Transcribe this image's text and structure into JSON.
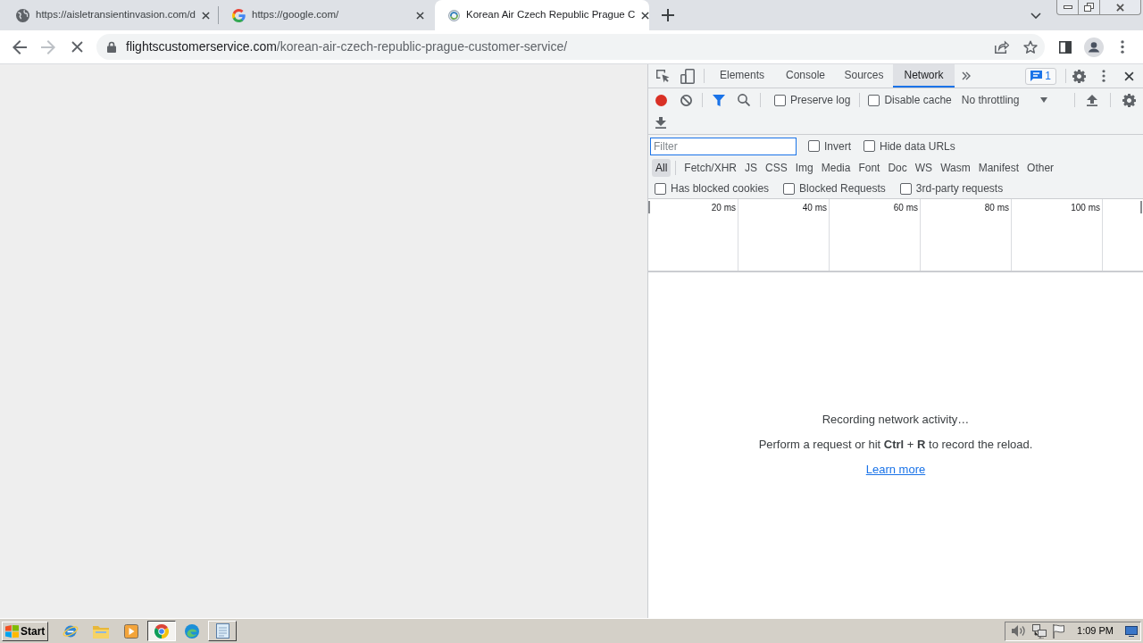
{
  "browser": {
    "tabs": [
      {
        "title": "https://aisletransientinvasion.com/d",
        "selected": false
      },
      {
        "title": "https://google.com/",
        "selected": false
      },
      {
        "title": "Korean Air Czech Republic Prague C",
        "selected": true
      }
    ],
    "loading": true,
    "forward_disabled": true,
    "url": {
      "domain": "flightscustomerservice.com",
      "path": "/korean-air-czech-republic-prague-customer-service/"
    }
  },
  "devtools": {
    "tabs": [
      {
        "label": "Elements",
        "selected": false
      },
      {
        "label": "Console",
        "selected": false
      },
      {
        "label": "Sources",
        "selected": false
      },
      {
        "label": "Network",
        "selected": true
      }
    ],
    "issues_count": "1",
    "network": {
      "recording": true,
      "options": [
        {
          "label": "Preserve log",
          "checked": false
        },
        {
          "label": "Disable cache",
          "checked": false
        }
      ],
      "throttling": "No throttling",
      "filter": {
        "placeholder": "Filter"
      },
      "filter_options": [
        {
          "label": "Invert",
          "checked": false
        },
        {
          "label": "Hide data URLs",
          "checked": false
        }
      ],
      "resource_types": [
        {
          "label": "All",
          "selected": true
        },
        {
          "label": "Fetch/XHR",
          "selected": false
        },
        {
          "label": "JS",
          "selected": false
        },
        {
          "label": "CSS",
          "selected": false
        },
        {
          "label": "Img",
          "selected": false
        },
        {
          "label": "Media",
          "selected": false
        },
        {
          "label": "Font",
          "selected": false
        },
        {
          "label": "Doc",
          "selected": false
        },
        {
          "label": "WS",
          "selected": false
        },
        {
          "label": "Wasm",
          "selected": false
        },
        {
          "label": "Manifest",
          "selected": false
        },
        {
          "label": "Other",
          "selected": false
        }
      ],
      "request_filters": [
        {
          "label": "Has blocked cookies",
          "checked": false
        },
        {
          "label": "Blocked Requests",
          "checked": false
        },
        {
          "label": "3rd-party requests",
          "checked": false
        }
      ],
      "timeline_ticks": [
        "20 ms",
        "40 ms",
        "60 ms",
        "80 ms",
        "100 ms"
      ],
      "empty_state": {
        "title": "Recording network activity…",
        "message": "Perform a request or hit **Ctrl** + **R** to record the reload.",
        "link": "Learn more"
      }
    }
  },
  "taskbar": {
    "start": "Start",
    "apps": [
      {
        "open": false,
        "active": false
      },
      {
        "open": false,
        "active": false
      },
      {
        "open": false,
        "active": false
      },
      {
        "open": true,
        "active": true
      },
      {
        "open": false,
        "active": false
      },
      {
        "open": true,
        "active": false
      }
    ],
    "clock": "1:09 PM"
  }
}
